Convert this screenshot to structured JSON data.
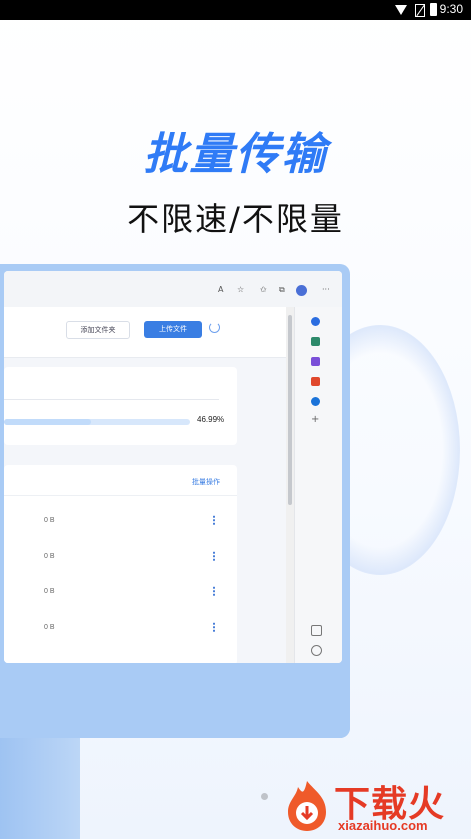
{
  "status_bar": {
    "time": "9:30"
  },
  "hero": {
    "title": "批量传输",
    "subtitle": "不限速/不限量"
  },
  "browser": {
    "toolbar_icons": [
      "read-aloud-icon",
      "favorite-icon",
      "favorites-icon",
      "collections-icon",
      "profile-icon",
      "more-icon"
    ],
    "more_label": "···"
  },
  "app": {
    "add_folder_label": "添加文件夹",
    "upload_label": "上传文件",
    "progress_percent": 46.99,
    "progress_label": "46.99%",
    "batch_label": "批量操作",
    "files": [
      {
        "size": "0 B"
      },
      {
        "size": "0 B"
      },
      {
        "size": "0 B"
      },
      {
        "size": "0 B"
      }
    ]
  },
  "sidebar_icons": [
    "search-icon",
    "shopping-icon",
    "tools-icon",
    "office-icon",
    "outlook-icon",
    "add-icon",
    "feedback-icon",
    "settings-icon"
  ],
  "watermark": {
    "title": "下载火",
    "site": "xiazaihuo.com"
  },
  "colors": {
    "accent": "#2f7bf6",
    "monitor": "#a9cbf5",
    "watermark": "#e53a25"
  }
}
